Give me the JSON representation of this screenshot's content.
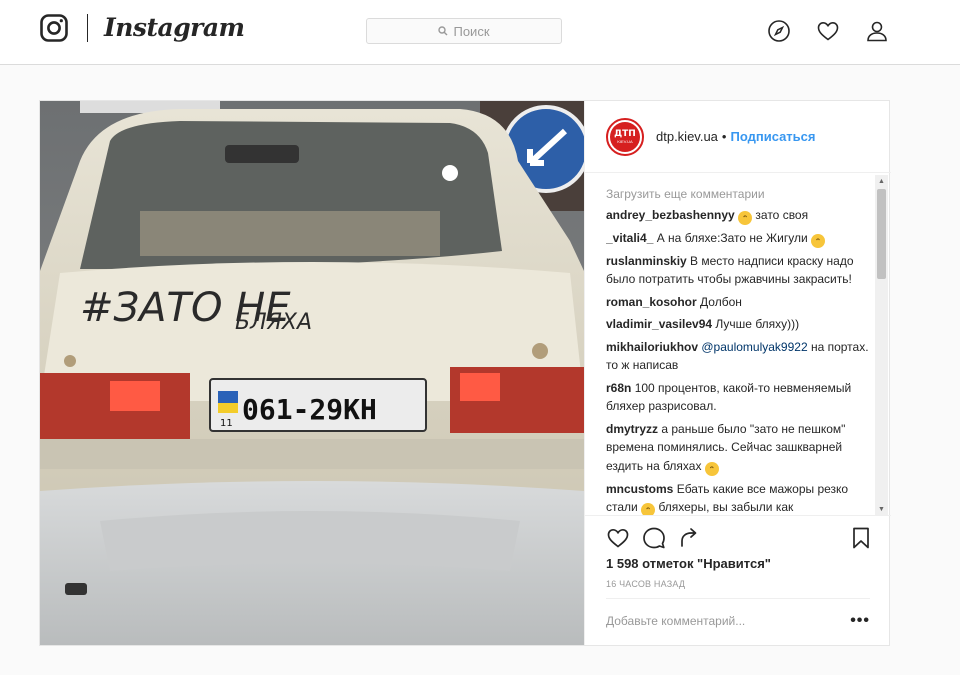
{
  "app": {
    "wordmark": "Instagram"
  },
  "search": {
    "placeholder": "Поиск"
  },
  "post": {
    "author": {
      "username": "dtp.kiev.ua",
      "avatar_line1": "ДТП",
      "avatar_line2": "KIEV.UA"
    },
    "header": {
      "separator": "•",
      "follow_label": "Подписаться"
    },
    "photo": {
      "plate_region": "11",
      "plate_number": "061-29КН",
      "graffiti_line1": "#ЗАТО НЕ",
      "graffiti_line2": "БЛЯХА"
    },
    "load_more_label": "Загрузить еще комментарии",
    "comments": [
      {
        "user": "andrey_bezbashennyy",
        "emoji": "😄",
        "text": "зато своя"
      },
      {
        "user": "_vitali4_",
        "text": "А на бляхе:Зато не Жигули",
        "emoji": "😂"
      },
      {
        "user": "ruslanminskiy",
        "text": "В место надписи краску надо было потратить чтобы ржавчины закрасить!"
      },
      {
        "user": "roman_kosohor",
        "text": "Долбон"
      },
      {
        "user": "vladimir_vasilev94",
        "text": "Лучше бляху)))"
      },
      {
        "user": "mikhailoriukhov",
        "mention": "@paulomulyak9922",
        "text": "на портах. то ж написав"
      },
      {
        "user": "r68n",
        "text": "100 процентов, какой-то невменяемый бляхер разрисовал."
      },
      {
        "user": "dmytryzz",
        "text": "а раньше было \"зато не пешком\" времена поминялись. Сейчас зашкварней ездить на бляхах",
        "emoji": "😄"
      },
      {
        "user": "mncustoms",
        "text": "Ебать какие все мажоры резко стали",
        "emoji": "😄",
        "text2": "бляхеры, вы забыли как"
      }
    ],
    "likes_text": "1 598 отметок \"Нравится\"",
    "timestamp": "16 ЧАСОВ НАЗАД",
    "add_comment_placeholder": "Добавьте комментарий...",
    "more_label": "•••"
  },
  "colors": {
    "accent": "#3897f0",
    "border": "#dbdbdb",
    "brand_red": "#d61f1f"
  }
}
